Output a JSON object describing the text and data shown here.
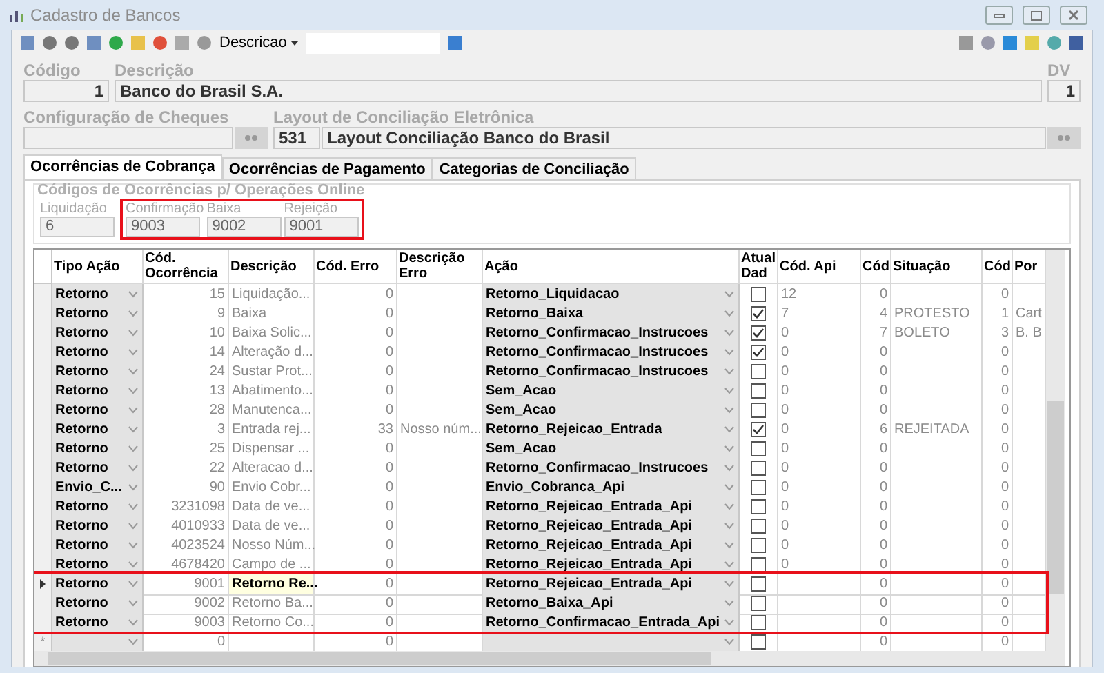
{
  "window": {
    "title": "Cadastro de Bancos"
  },
  "toolbar": {
    "filter_label": "Descricao"
  },
  "fields": {
    "codigo": {
      "label": "Código",
      "value": "1"
    },
    "descricao": {
      "label": "Descrição",
      "value": "Banco do Brasil S.A."
    },
    "dv": {
      "label": "DV",
      "value": "1"
    },
    "cheques": {
      "label": "Configuração de Cheques"
    },
    "layout": {
      "label": "Layout de Conciliação Eletrônica",
      "code": "531",
      "value": "Layout Conciliação Banco do Brasil"
    }
  },
  "tabs": [
    {
      "label": "Ocorrências de Cobrança",
      "selected": true
    },
    {
      "label": "Ocorrências de Pagamento",
      "selected": false
    },
    {
      "label": "Categorias de Conciliação",
      "selected": false
    }
  ],
  "online_group": {
    "title": "Códigos de Ocorrências p/ Operações Online",
    "fields": [
      {
        "label": "Liquidação",
        "value": "6",
        "highlighted": false
      },
      {
        "label": "Confirmação",
        "value": "9003",
        "highlighted": true
      },
      {
        "label": "Baixa",
        "value": "9002",
        "highlighted": true
      },
      {
        "label": "Rejeição",
        "value": "9001",
        "highlighted": true
      }
    ]
  },
  "table": {
    "columns": [
      "Tipo Ação",
      "Cód. Ocorrência",
      "Descrição",
      "Cód. Erro",
      "Descrição Erro",
      "Ação",
      "Atual Dad",
      "Cód. Api",
      "Cód",
      "Situação",
      "Cód",
      "Por"
    ],
    "rows": [
      {
        "tipo": "Retorno",
        "cod": "15",
        "desc": "Liquidação...",
        "cod_erro": "0",
        "desc_erro": "",
        "acao": "Retorno_Liquidacao",
        "atual": false,
        "cod_api": "12",
        "cod2": "0",
        "situacao": "",
        "cod3": "0",
        "por": "",
        "selected": false,
        "highlighted": false
      },
      {
        "tipo": "Retorno",
        "cod": "9",
        "desc": "Baixa",
        "cod_erro": "0",
        "desc_erro": "",
        "acao": "Retorno_Baixa",
        "atual": true,
        "cod_api": "7",
        "cod2": "4",
        "situacao": "PROTESTO",
        "cod3": "1",
        "por": "Cart",
        "selected": false,
        "highlighted": false
      },
      {
        "tipo": "Retorno",
        "cod": "10",
        "desc": "Baixa Solic...",
        "cod_erro": "0",
        "desc_erro": "",
        "acao": "Retorno_Confirmacao_Instrucoes",
        "atual": true,
        "cod_api": "0",
        "cod2": "7",
        "situacao": "BOLETO",
        "cod3": "3",
        "por": "B. B",
        "selected": false,
        "highlighted": false
      },
      {
        "tipo": "Retorno",
        "cod": "14",
        "desc": "Alteração d...",
        "cod_erro": "0",
        "desc_erro": "",
        "acao": "Retorno_Confirmacao_Instrucoes",
        "atual": true,
        "cod_api": "0",
        "cod2": "0",
        "situacao": "",
        "cod3": "0",
        "por": "",
        "selected": false,
        "highlighted": false
      },
      {
        "tipo": "Retorno",
        "cod": "24",
        "desc": "Sustar Prot...",
        "cod_erro": "0",
        "desc_erro": "",
        "acao": "Retorno_Confirmacao_Instrucoes",
        "atual": false,
        "cod_api": "0",
        "cod2": "0",
        "situacao": "",
        "cod3": "0",
        "por": "",
        "selected": false,
        "highlighted": false
      },
      {
        "tipo": "Retorno",
        "cod": "13",
        "desc": "Abatimento...",
        "cod_erro": "0",
        "desc_erro": "",
        "acao": "Sem_Acao",
        "atual": false,
        "cod_api": "0",
        "cod2": "0",
        "situacao": "",
        "cod3": "0",
        "por": "",
        "selected": false,
        "highlighted": false
      },
      {
        "tipo": "Retorno",
        "cod": "28",
        "desc": "Manutenca...",
        "cod_erro": "0",
        "desc_erro": "",
        "acao": "Sem_Acao",
        "atual": false,
        "cod_api": "0",
        "cod2": "0",
        "situacao": "",
        "cod3": "0",
        "por": "",
        "selected": false,
        "highlighted": false
      },
      {
        "tipo": "Retorno",
        "cod": "3",
        "desc": "Entrada rej...",
        "cod_erro": "33",
        "desc_erro": "Nosso núm...",
        "acao": "Retorno_Rejeicao_Entrada",
        "atual": true,
        "cod_api": "0",
        "cod2": "6",
        "situacao": "REJEITADA",
        "cod3": "0",
        "por": "",
        "selected": false,
        "highlighted": false
      },
      {
        "tipo": "Retorno",
        "cod": "25",
        "desc": "Dispensar ...",
        "cod_erro": "0",
        "desc_erro": "",
        "acao": "Sem_Acao",
        "atual": false,
        "cod_api": "0",
        "cod2": "0",
        "situacao": "",
        "cod3": "0",
        "por": "",
        "selected": false,
        "highlighted": false
      },
      {
        "tipo": "Retorno",
        "cod": "22",
        "desc": "Alteracao d...",
        "cod_erro": "0",
        "desc_erro": "",
        "acao": "Retorno_Confirmacao_Instrucoes",
        "atual": false,
        "cod_api": "0",
        "cod2": "0",
        "situacao": "",
        "cod3": "0",
        "por": "",
        "selected": false,
        "highlighted": false
      },
      {
        "tipo": "Envio_C...",
        "cod": "90",
        "desc": "Envio Cobr...",
        "cod_erro": "0",
        "desc_erro": "",
        "acao": "Envio_Cobranca_Api",
        "atual": false,
        "cod_api": "0",
        "cod2": "0",
        "situacao": "",
        "cod3": "0",
        "por": "",
        "selected": false,
        "highlighted": false
      },
      {
        "tipo": "Retorno",
        "cod": "3231098",
        "desc": "Data de ve...",
        "cod_erro": "0",
        "desc_erro": "",
        "acao": "Retorno_Rejeicao_Entrada_Api",
        "atual": false,
        "cod_api": "0",
        "cod2": "0",
        "situacao": "",
        "cod3": "0",
        "por": "",
        "selected": false,
        "highlighted": false
      },
      {
        "tipo": "Retorno",
        "cod": "4010933",
        "desc": "Data de ve...",
        "cod_erro": "0",
        "desc_erro": "",
        "acao": "Retorno_Rejeicao_Entrada_Api",
        "atual": false,
        "cod_api": "0",
        "cod2": "0",
        "situacao": "",
        "cod3": "0",
        "por": "",
        "selected": false,
        "highlighted": false
      },
      {
        "tipo": "Retorno",
        "cod": "4023524",
        "desc": "Nosso Núm...",
        "cod_erro": "0",
        "desc_erro": "",
        "acao": "Retorno_Rejeicao_Entrada_Api",
        "atual": false,
        "cod_api": "0",
        "cod2": "0",
        "situacao": "",
        "cod3": "0",
        "por": "",
        "selected": false,
        "highlighted": false
      },
      {
        "tipo": "Retorno",
        "cod": "4678420",
        "desc": "Campo de ...",
        "cod_erro": "0",
        "desc_erro": "",
        "acao": "Retorno_Rejeicao_Entrada_Api",
        "atual": false,
        "cod_api": "0",
        "cod2": "0",
        "situacao": "",
        "cod3": "0",
        "por": "",
        "selected": false,
        "highlighted": false
      },
      {
        "tipo": "Retorno",
        "cod": "9001",
        "desc": "Retorno Re...",
        "cod_erro": "0",
        "desc_erro": "",
        "acao": "Retorno_Rejeicao_Entrada_Api",
        "atual": false,
        "cod_api": "",
        "cod2": "0",
        "situacao": "",
        "cod3": "0",
        "por": "",
        "selected": true,
        "highlighted": true
      },
      {
        "tipo": "Retorno",
        "cod": "9002",
        "desc": "Retorno Ba...",
        "cod_erro": "0",
        "desc_erro": "",
        "acao": "Retorno_Baixa_Api",
        "atual": false,
        "cod_api": "",
        "cod2": "0",
        "situacao": "",
        "cod3": "0",
        "por": "",
        "selected": false,
        "highlighted": true
      },
      {
        "tipo": "Retorno",
        "cod": "9003",
        "desc": "Retorno Co...",
        "cod_erro": "0",
        "desc_erro": "",
        "acao": "Retorno_Confirmacao_Entrada_Api",
        "atual": false,
        "cod_api": "",
        "cod2": "0",
        "situacao": "",
        "cod3": "0",
        "por": "",
        "selected": false,
        "highlighted": true
      }
    ],
    "new_row": {
      "marker": "*",
      "cod": "0",
      "cod_erro": "0",
      "atual": false,
      "cod2": "0",
      "cod3": "0"
    }
  }
}
